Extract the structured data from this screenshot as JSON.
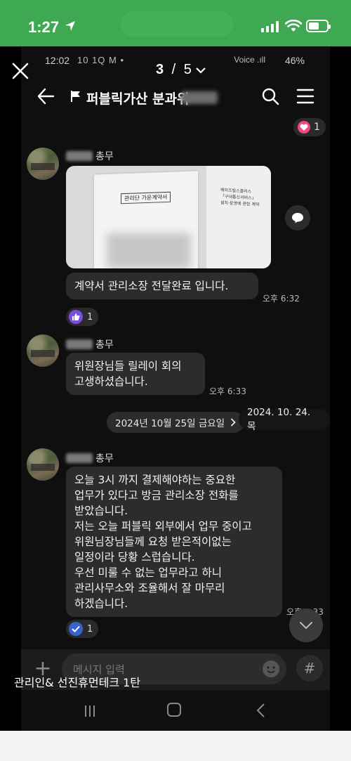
{
  "ios_status": {
    "time": "1:27"
  },
  "viewer": {
    "current": "3",
    "separator": " / ",
    "total": "5"
  },
  "android_status": {
    "time": "12:02",
    "icons": "10 1Q M •",
    "battery": "46%",
    "signal_icons": "Voice .ıll"
  },
  "room": {
    "title": "퍼블릭가산 분과위"
  },
  "reaction_top": {
    "count": "1"
  },
  "messages": [
    {
      "sender_role": "총무"
    },
    {
      "sender_role": "총무"
    },
    {
      "sender_role": "총무"
    }
  ],
  "photo_doc": {
    "label": "관리단 가운계약서",
    "side_text": "헤이즈빌스플러스\n「구내통신서비스」\n설치·운영에 관한 계약"
  },
  "msg1": {
    "text": "계약서 관리소장 전달완료 입니다.",
    "time": "오후 6:32",
    "reaction_count": "1"
  },
  "msg2": {
    "lines": [
      "위원장님들 릴레이 회의",
      "고생하셨습니다."
    ],
    "time": "오후 6:33"
  },
  "date_separator": {
    "label": "2024년 10월 25일 금요일",
    "tip": "2024. 10. 24. 목"
  },
  "msg3": {
    "lines": [
      "오늘 3시 까지 결제해야하는 중요한",
      "업무가 있다고 방금 관리소장 전화를",
      "받았습니다.",
      "저는 오늘 퍼블릭 외부에서 업무 중이고",
      "위원님장님들께 요청 받은적이없는",
      "일정이라 당황 스럽습니다.",
      "우선 미룰 수 없는 업무라고 하니",
      "관리사무소와 조율해서 잘 마무리",
      "하겠습니다."
    ],
    "time": "오후 1:33",
    "reaction_count": "1"
  },
  "input": {
    "placeholder": "메시지 입력"
  },
  "caption": "관리인& 선진휴먼테크 1탄"
}
